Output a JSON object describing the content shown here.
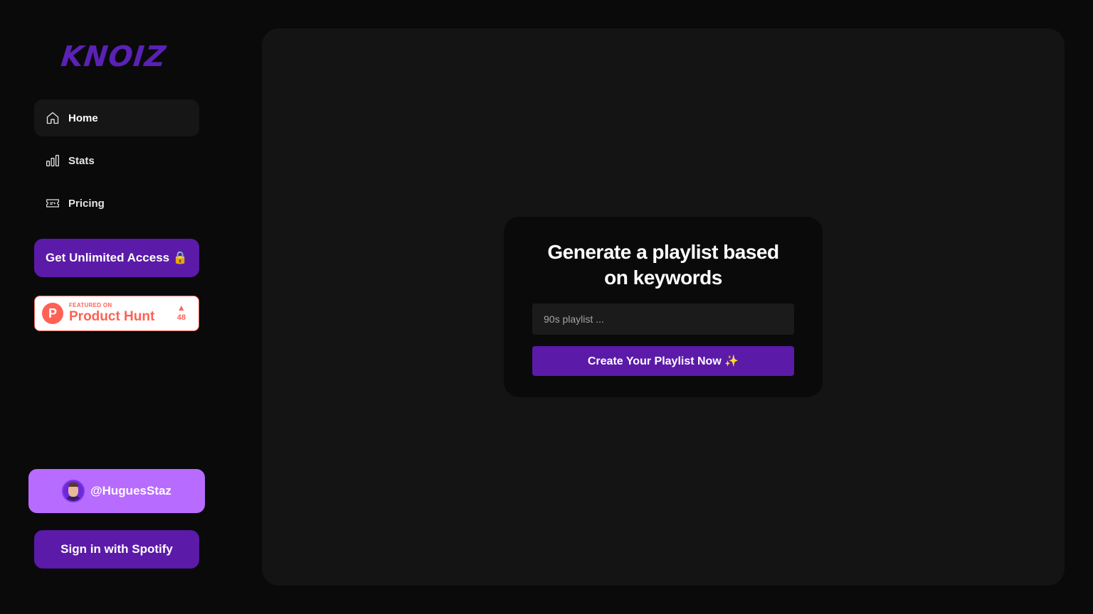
{
  "brand": {
    "logo_text": "KNOIZ",
    "color": "#5b21b6"
  },
  "sidebar": {
    "items": [
      {
        "label": "Home",
        "icon": "home-icon",
        "active": true
      },
      {
        "label": "Stats",
        "icon": "bar-chart-icon",
        "active": false
      },
      {
        "label": "Pricing",
        "icon": "ticket-icon",
        "active": false
      }
    ],
    "unlimited_label": "Get Unlimited Access 🔒",
    "product_hunt": {
      "featured": "FEATURED ON",
      "name": "Product Hunt",
      "logo_letter": "P",
      "votes": "48",
      "arrow": "▲",
      "color": "#ff6154"
    },
    "user": {
      "handle": "@HuguesStaz"
    },
    "spotify_label": "Sign in with Spotify"
  },
  "main": {
    "card": {
      "title": "Generate a playlist based on keywords",
      "input_placeholder": "90s playlist ...",
      "input_value": "",
      "button_label": "Create Your Playlist Now ✨"
    }
  },
  "colors": {
    "accent": "#5b1aa8",
    "user_card": "#b86bff",
    "background": "#0a0a0a",
    "panel": "#141414"
  }
}
